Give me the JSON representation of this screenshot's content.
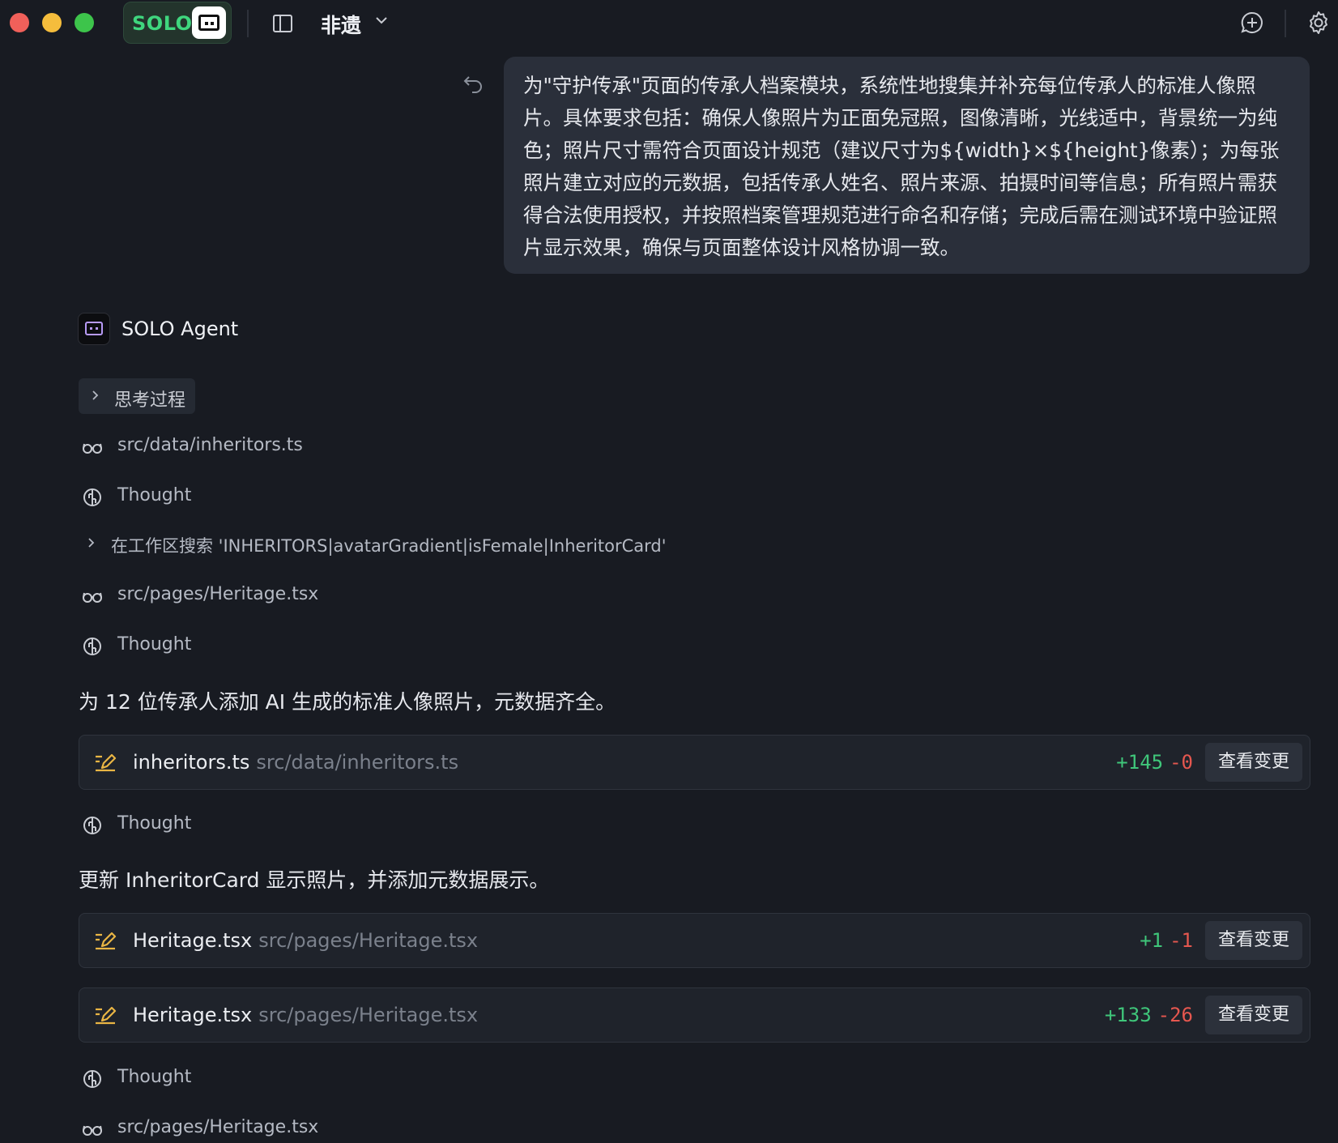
{
  "titlebar": {
    "brand": "SOLO",
    "project_name": "非遗"
  },
  "user_message": "为\"守护传承\"页面的传承人档案模块，系统性地搜集并补充每位传承人的标准人像照片。具体要求包括：确保人像照片为正面免冠照，图像清晰，光线适中，背景统一为纯色；照片尺寸需符合页面设计规范（建议尺寸为${width}×${height}像素）；为每张照片建立对应的元数据，包括传承人姓名、照片来源、拍摄时间等信息；所有照片需获得合法使用授权，并按照档案管理规范进行命名和存储；完成后需在测试环境中验证照片显示效果，确保与页面整体设计风格协调一致。",
  "agent": {
    "name": "SOLO Agent",
    "thinking_label": "思考过程"
  },
  "steps": [
    {
      "kind": "read",
      "icon": "glasses-icon",
      "label": "src/data/inheritors.ts"
    },
    {
      "kind": "thought",
      "icon": "brain-icon",
      "label": "Thought"
    },
    {
      "kind": "search",
      "icon": "chevron-right-icon",
      "label": "在工作区搜索 'INHERITORS|avatarGradient|isFemale|InheritorCard'"
    },
    {
      "kind": "read",
      "icon": "glasses-icon",
      "label": "src/pages/Heritage.tsx"
    },
    {
      "kind": "thought",
      "icon": "brain-icon",
      "label": "Thought"
    },
    {
      "kind": "thought",
      "icon": "brain-icon",
      "label": "Thought"
    },
    {
      "kind": "thought",
      "icon": "brain-icon",
      "label": "Thought"
    },
    {
      "kind": "read",
      "icon": "glasses-icon",
      "label": "src/pages/Heritage.tsx"
    }
  ],
  "summaries": [
    "为 12 位传承人添加 AI 生成的标准人像照片，元数据齐全。",
    "更新 InheritorCard 显示照片，并添加元数据展示。"
  ],
  "file_changes": [
    {
      "name": "inheritors.ts",
      "path": "src/data/inheritors.ts",
      "added": "+145",
      "removed": "-0",
      "button": "查看变更"
    },
    {
      "name": "Heritage.tsx",
      "path": "src/pages/Heritage.tsx",
      "added": "+1",
      "removed": "-1",
      "button": "查看变更"
    },
    {
      "name": "Heritage.tsx",
      "path": "src/pages/Heritage.tsx",
      "added": "+133",
      "removed": "-26",
      "button": "查看变更"
    }
  ],
  "colors": {
    "background": "#181b22",
    "brand_green": "#3fd67e",
    "diff_add": "#3fc67a",
    "diff_remove": "#e5574f",
    "edit_icon": "#e9b544",
    "agent_accent": "#b79af5"
  }
}
